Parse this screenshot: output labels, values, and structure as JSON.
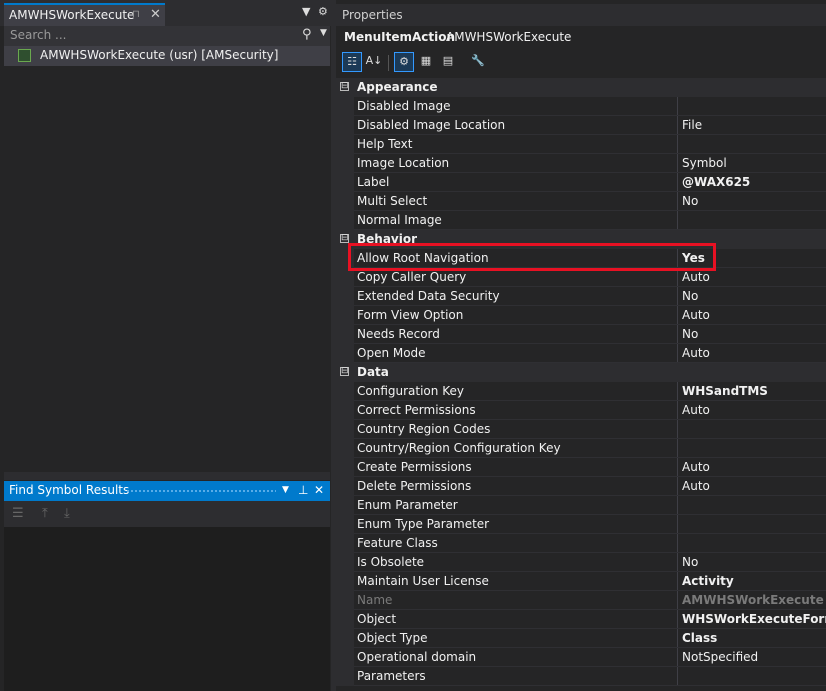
{
  "left": {
    "tab_title": "AMWHSWorkExecute",
    "tab_pin_icon": "pin-icon",
    "tab_close_icon": "close-icon",
    "search_placeholder": "Search ...",
    "tree_item": "AMWHSWorkExecute (usr) [AMSecurity]"
  },
  "find_symbol": {
    "title": "Find Symbol Results"
  },
  "properties": {
    "panel_title": "Properties",
    "object_type": "MenuItemAction",
    "object_name": "AMWHSWorkExecute",
    "categories": [
      {
        "name": "Appearance",
        "expander": "⊟",
        "props": [
          {
            "name": "Disabled Image",
            "value": ""
          },
          {
            "name": "Disabled Image Location",
            "value": "File"
          },
          {
            "name": "Help Text",
            "value": ""
          },
          {
            "name": "Image Location",
            "value": "Symbol"
          },
          {
            "name": "Label",
            "value": "@WAX625",
            "bold": true
          },
          {
            "name": "Multi Select",
            "value": "No"
          },
          {
            "name": "Normal Image",
            "value": ""
          }
        ]
      },
      {
        "name": "Behavior",
        "expander": "⊟",
        "props": [
          {
            "name": "Allow Root Navigation",
            "value": "Yes",
            "bold": true
          },
          {
            "name": "Copy Caller Query",
            "value": "Auto"
          },
          {
            "name": "Extended Data Security",
            "value": "No"
          },
          {
            "name": "Form View Option",
            "value": "Auto"
          },
          {
            "name": "Needs Record",
            "value": "No"
          },
          {
            "name": "Open Mode",
            "value": "Auto"
          }
        ]
      },
      {
        "name": "Data",
        "expander": "⊟",
        "props": [
          {
            "name": "Configuration Key",
            "value": "WHSandTMS",
            "bold": true
          },
          {
            "name": "Correct Permissions",
            "value": "Auto"
          },
          {
            "name": "Country Region Codes",
            "value": ""
          },
          {
            "name": "Country/Region Configuration Key",
            "value": ""
          },
          {
            "name": "Create Permissions",
            "value": "Auto"
          },
          {
            "name": "Delete Permissions",
            "value": "Auto"
          },
          {
            "name": "Enum Parameter",
            "value": ""
          },
          {
            "name": "Enum Type Parameter",
            "value": ""
          },
          {
            "name": "Feature Class",
            "value": ""
          },
          {
            "name": "Is Obsolete",
            "value": "No"
          },
          {
            "name": "Maintain User License",
            "value": "Activity",
            "bold": true
          },
          {
            "name": "Name",
            "value": "AMWHSWorkExecute",
            "bold": true,
            "dim": true
          },
          {
            "name": "Object",
            "value": "WHSWorkExecuteForm",
            "bold": true
          },
          {
            "name": "Object Type",
            "value": "Class",
            "bold": true
          },
          {
            "name": "Operational domain",
            "value": "NotSpecified"
          },
          {
            "name": "Parameters",
            "value": ""
          }
        ]
      }
    ]
  },
  "accent_color": "#007acc",
  "highlight_color": "#e81123"
}
